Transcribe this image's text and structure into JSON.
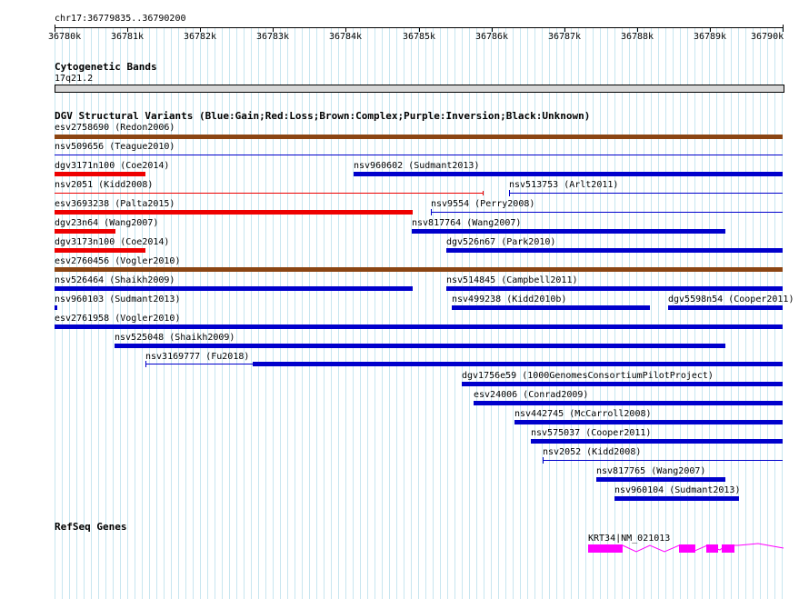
{
  "ruler": {
    "position": "chr17:36779835..36790200",
    "ticks": [
      "36780k",
      "36781k",
      "36782k",
      "36783k",
      "36784k",
      "36785k",
      "36786k",
      "36787k",
      "36788k",
      "36789k",
      "36790k"
    ]
  },
  "cytoband": {
    "title": "Cytogenetic Bands",
    "band": "17q21.2"
  },
  "dgv": {
    "title": "DGV Structural Variants (Blue:Gain;Red:Loss;Brown:Complex;Purple:Inversion;Black:Unknown)",
    "colors": {
      "gain": "#0000cc",
      "loss": "#ee0000",
      "complex": "#8b4513",
      "inversion": "#800080",
      "unknown": "#000000"
    }
  },
  "refseq": {
    "title": "RefSeq Genes",
    "gene": "KRT34|NM_021013",
    "color": "#ff00ff"
  },
  "features": [
    {
      "label": "esv2758690 (Redon2006)",
      "color": "complex"
    },
    {
      "label": "nsv509656 (Teague2010)",
      "color": "gain"
    },
    {
      "label": "dgv3171n100 (Coe2014)",
      "color": "loss"
    },
    {
      "label": "nsv960602 (Sudmant2013)",
      "color": "gain"
    },
    {
      "label": "nsv2051 (Kidd2008)",
      "color": "loss"
    },
    {
      "label": "nsv513753 (Arlt2011)",
      "color": "gain"
    },
    {
      "label": "esv3693238 (Palta2015)",
      "color": "loss"
    },
    {
      "label": "nsv9554 (Perry2008)",
      "color": "gain"
    },
    {
      "label": "dgv23n64 (Wang2007)",
      "color": "loss"
    },
    {
      "label": "nsv817764 (Wang2007)",
      "color": "gain"
    },
    {
      "label": "dgv3173n100 (Coe2014)",
      "color": "loss"
    },
    {
      "label": "dgv526n67 (Park2010)",
      "color": "gain"
    },
    {
      "label": "esv2760456 (Vogler2010)",
      "color": "complex"
    },
    {
      "label": "nsv526464 (Shaikh2009)",
      "color": "gain"
    },
    {
      "label": "nsv514845 (Campbell2011)",
      "color": "gain"
    },
    {
      "label": "nsv960103 (Sudmant2013)",
      "color": "gain"
    },
    {
      "label": "nsv499238 (Kidd2010b)",
      "color": "gain"
    },
    {
      "label": "dgv5598n54 (Cooper2011)",
      "color": "gain"
    },
    {
      "label": "esv2761958 (Vogler2010)",
      "color": "gain"
    },
    {
      "label": "nsv525048 (Shaikh2009)",
      "color": "gain"
    },
    {
      "label": "nsv3169777 (Fu2018)",
      "color": "gain"
    },
    {
      "label": "dgv1756e59 (1000GenomesConsortiumPilotProject)",
      "color": "gain"
    },
    {
      "label": "esv24006 (Conrad2009)",
      "color": "gain"
    },
    {
      "label": "nsv442745 (McCarroll2008)",
      "color": "gain"
    },
    {
      "label": "nsv575037 (Cooper2011)",
      "color": "gain"
    },
    {
      "label": "nsv2052 (Kidd2008)",
      "color": "gain"
    },
    {
      "label": "nsv817765 (Wang2007)",
      "color": "gain"
    },
    {
      "label": "nsv960104 (Sudmant2013)",
      "color": "gain"
    }
  ]
}
